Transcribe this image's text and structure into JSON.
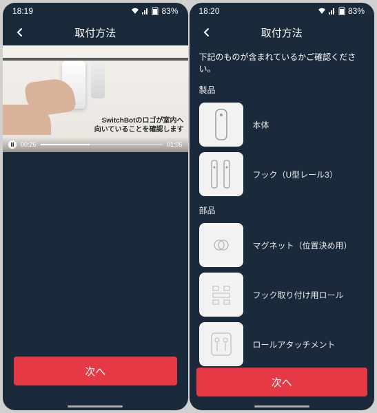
{
  "left": {
    "status": {
      "time": "18:19",
      "battery": "83%"
    },
    "header": {
      "title": "取付方法"
    },
    "video": {
      "caption_line1": "SwitchBotのロゴが室内へ",
      "caption_line2": "向いていることを確認します",
      "current_time": "00:26",
      "duration": "01:05"
    },
    "next": "次へ"
  },
  "right": {
    "status": {
      "time": "18:20",
      "battery": "83%"
    },
    "header": {
      "title": "取付方法"
    },
    "instruction": "下記のものが含まれているかご確認ください。",
    "sections": {
      "products_label": "製品",
      "parts_label": "部品"
    },
    "items": {
      "body": "本体",
      "hook": "フック（U型レール3）",
      "magnet": "マグネット（位置決め用）",
      "roll": "フック取り付け用ロール",
      "attachment": "ロールアタッチメント"
    },
    "next": "次へ"
  }
}
